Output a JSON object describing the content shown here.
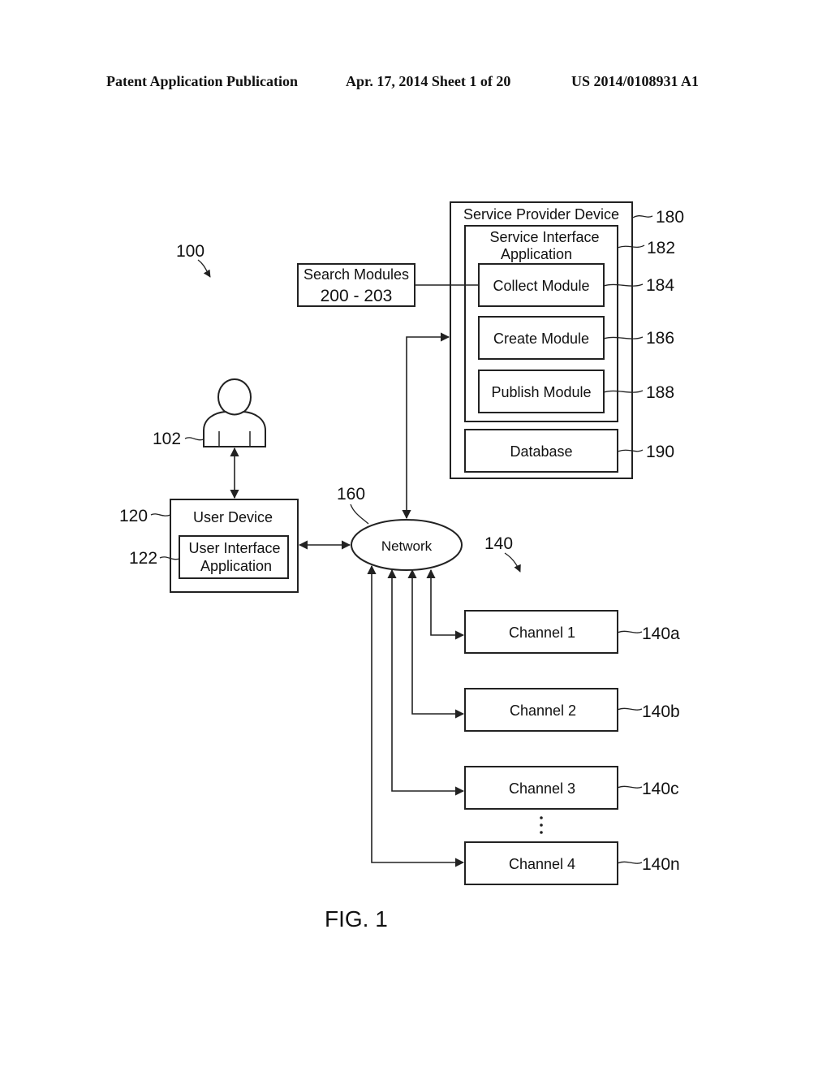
{
  "header": {
    "left": "Patent Application Publication",
    "middle": "Apr. 17, 2014  Sheet 1 of 20",
    "right": "US 2014/0108931 A1"
  },
  "diagram": {
    "system_ref": "100",
    "user": {
      "ref": "102"
    },
    "user_device": {
      "label": "User Device",
      "ref": "120",
      "app": {
        "label_line1": "User Interface",
        "label_line2": "Application",
        "ref": "122"
      }
    },
    "network": {
      "label": "Network",
      "ref": "160"
    },
    "search_modules": {
      "label_line1": "Search Modules",
      "label_line2": "200 - 203"
    },
    "service_provider": {
      "label": "Service Provider Device",
      "ref": "180",
      "app": {
        "label_line1": "Service Interface",
        "label_line2": "Application",
        "ref": "182"
      },
      "modules": [
        {
          "label": "Collect Module",
          "ref": "184"
        },
        {
          "label": "Create Module",
          "ref": "186"
        },
        {
          "label": "Publish Module",
          "ref": "188"
        }
      ],
      "database": {
        "label": "Database",
        "ref": "190"
      }
    },
    "channels_ref": "140",
    "channels": [
      {
        "label": "Channel 1",
        "ref": "140a"
      },
      {
        "label": "Channel 2",
        "ref": "140b"
      },
      {
        "label": "Channel 3",
        "ref": "140c"
      },
      {
        "label": "Channel 4",
        "ref": "140n"
      }
    ],
    "ellipsis": "⋮"
  },
  "figure_label": "FIG. 1"
}
